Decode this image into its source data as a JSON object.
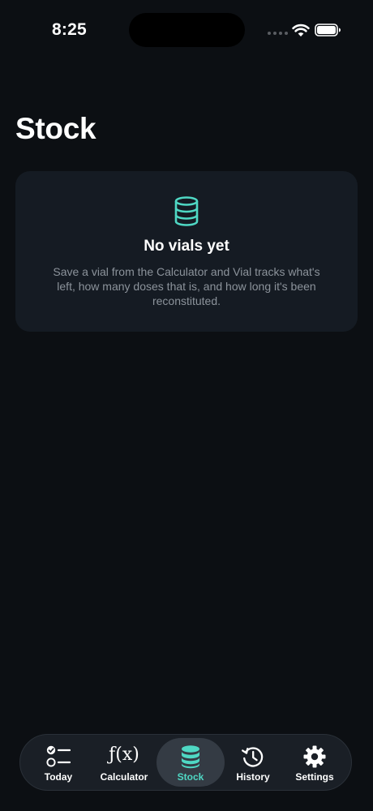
{
  "status_bar": {
    "time": "8:25"
  },
  "page": {
    "title": "Stock"
  },
  "empty_state": {
    "icon": "database-icon",
    "title": "No vials yet",
    "description": "Save a vial from the Calculator and Vial tracks what's left, how many doses that is, and how long it's been reconstituted."
  },
  "tab_bar": {
    "active_tab": "Stock",
    "tabs": [
      {
        "label": "Today",
        "icon": "checklist-icon"
      },
      {
        "label": "Calculator",
        "icon": "function-icon",
        "glyph": "ƒ(x)"
      },
      {
        "label": "Stock",
        "icon": "database-icon"
      },
      {
        "label": "History",
        "icon": "history-icon"
      },
      {
        "label": "Settings",
        "icon": "gear-icon"
      }
    ]
  },
  "colors": {
    "background": "#0c0f13",
    "card": "#151b23",
    "accent": "#4fd8c4",
    "muted_text": "#8c939b"
  }
}
